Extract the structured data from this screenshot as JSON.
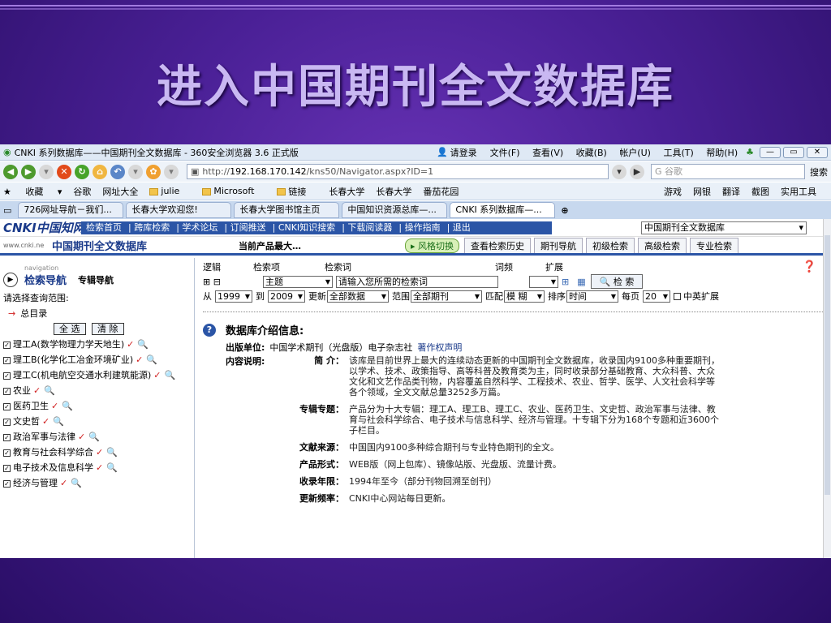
{
  "slide": {
    "title": "进入中国期刊全文数据库"
  },
  "colors": {
    "slide_bg": "#4a2096",
    "title_text": "#c9b8f2",
    "cnki_blue": "#2b55a6",
    "check_red": "#d02020"
  },
  "browser": {
    "window_title": "CNKI 系列数据库——中国期刊全文数据库 - 360安全浏览器 3.6 正式版",
    "login": "请登录",
    "menu": [
      "文件(F)",
      "查看(V)",
      "收藏(B)",
      "帐户(U)",
      "工具(T)",
      "帮助(H)"
    ],
    "address_prefix": "http://",
    "address_host": "192.168.170.142",
    "address_path": "/kns50/Navigator.aspx?ID=1",
    "search_placeholder": "谷歌",
    "search_button": "搜索",
    "favorites": [
      "收藏",
      "谷歌",
      "网址大全",
      "julie",
      "Microsoft",
      "链接",
      "长春大学",
      "长春大学",
      "番茄花园"
    ],
    "fav_right": [
      "游戏",
      "网银",
      "翻译",
      "截图",
      "实用工具"
    ],
    "tabs": [
      "726网址导航－我们...",
      "长春大学欢迎您!",
      "长春大学图书馆主页",
      "中国知识资源总库—...",
      "CNKI 系列数据库—..."
    ]
  },
  "cnki": {
    "logo": "CNKI中国知网",
    "logo_sub": "www.cnki.net",
    "top_nav": [
      "检索首页",
      "跨库检索",
      "学术论坛",
      "订阅推送",
      "CNKI知识搜索",
      "下载阅读器",
      "操作指南",
      "退出"
    ],
    "db_select": "中国期刊全文数据库",
    "db_name": "中国期刊全文数据库",
    "product_label": "当前产品最大…",
    "style_switch": "风格切换",
    "sub_buttons": [
      "查看检索历史",
      "期刊导航",
      "初级检索",
      "高级检索",
      "专业检索"
    ]
  },
  "left": {
    "nav_small": "navigation",
    "nav_title": "检索导航",
    "nav_tab2": "专辑导航",
    "range_label": "请选择查询范围:",
    "root": "总目录",
    "select_all": "全 选",
    "clear": "清 除",
    "categories": [
      "理工A(数学物理力学天地生)",
      "理工B(化学化工冶金环境矿业)",
      "理工C(机电航空交通水利建筑能源)",
      "农业",
      "医药卫生",
      "文史哲",
      "政治军事与法律",
      "教育与社会科学综合",
      "电子技术及信息科学",
      "经济与管理"
    ]
  },
  "query": {
    "h_logic": "逻辑",
    "h_field": "检索项",
    "h_keyword": "检索词",
    "h_freq": "词频",
    "h_expand": "扩展",
    "field_value": "主题",
    "keyword_placeholder": "请输入您所需的检索词",
    "search_button": "检 索",
    "from": "从",
    "year_from": "1999",
    "to": "到",
    "year_to": "2009",
    "update_label": "更新",
    "update_value": "全部数据",
    "range_label": "范围",
    "range_value": "全部期刊",
    "match_label": "匹配",
    "match_value": "模 糊",
    "sort_label": "排序",
    "sort_value": "时间",
    "perpage_label": "每页",
    "perpage_value": "20",
    "cn_en": "中英扩展"
  },
  "info": {
    "title": "数据库介绍信息:",
    "publisher_label": "出版单位:",
    "publisher": "中国学术期刊（光盘版）电子杂志社",
    "copyright": "著作权声明",
    "content_label": "内容说明:",
    "rows": [
      {
        "label": "简 介：",
        "text": "该库是目前世界上最大的连续动态更新的中国期刊全文数据库，收录国内9100多种重要期刊，以学术、技术、政策指导、高等科普及教育类为主，同时收录部分基础教育、大众科普、大众文化和文艺作品类刊物，内容覆盖自然科学、工程技术、农业、哲学、医学、人文社会科学等各个领域，全文文献总量3252多万篇。"
      },
      {
        "label": "专辑专题：",
        "text": "产品分为十大专辑：理工A、理工B、理工C、农业、医药卫生、文史哲、政治军事与法律、教育与社会科学综合、电子技术与信息科学、经济与管理。十专辑下分为168个专题和近3600个子栏目。"
      },
      {
        "label": "文献来源：",
        "text": "中国国内9100多种综合期刊与专业特色期刊的全文。"
      },
      {
        "label": "产品形式：",
        "text": "WEB版（网上包库）、镜像站版、光盘版、流量计费。"
      },
      {
        "label": "收录年限：",
        "text": "1994年至今（部分刊物回溯至创刊）"
      },
      {
        "label": "更新频率：",
        "text": "CNKI中心网站每日更新。"
      }
    ]
  }
}
